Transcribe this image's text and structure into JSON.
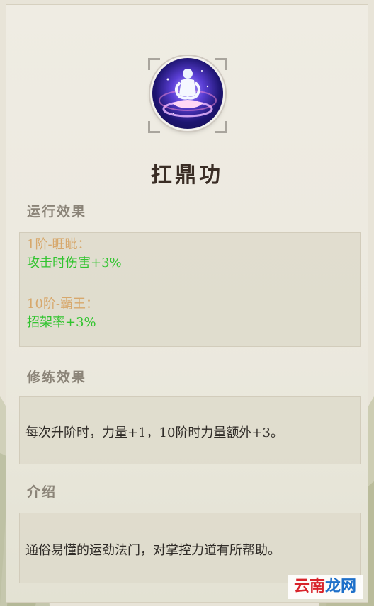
{
  "skill": {
    "name": "扛鼎功",
    "icon": "meditation-orb-icon"
  },
  "sections": {
    "run_effect": {
      "label": "运行效果",
      "entries": [
        {
          "rank": "1阶-睚眦：",
          "bonus": "攻击时伤害+3%"
        },
        {
          "rank": "10阶-霸王：",
          "bonus": "招架率+3%"
        }
      ]
    },
    "train_effect": {
      "label": "修练效果",
      "text": "每次升阶时，力量+1，10阶时力量额外+3。"
    },
    "intro": {
      "label": "介绍",
      "text": "通俗易懂的运劲法门，对掌控力道有所帮助。"
    }
  },
  "watermark": {
    "text_red": "云南",
    "text_blue": "龙网"
  },
  "colors": {
    "rank": "#d7a86c",
    "bonus": "#31c42f",
    "title": "#3a2d25",
    "label": "#8b8478"
  }
}
